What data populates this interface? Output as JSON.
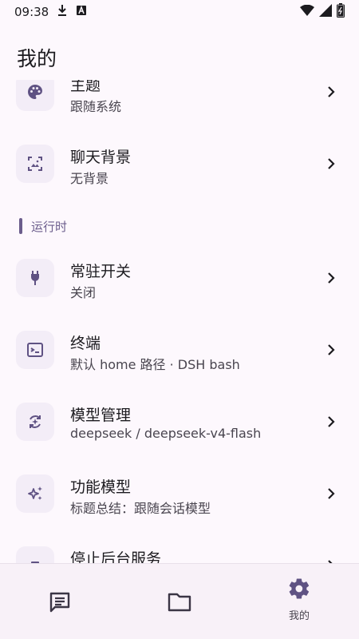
{
  "status_bar": {
    "time": "09:38",
    "icons": [
      "download-icon",
      "a-icon",
      "wifi-icon",
      "signal-icon",
      "battery-icon"
    ]
  },
  "page_title": "我的",
  "settings": {
    "partial_top_item": {
      "title": "主题",
      "subtitle": "跟随系统",
      "icon": "palette-icon"
    },
    "items_before": [
      {
        "title": "聊天背景",
        "subtitle": "无背景",
        "icon": "wallpaper-icon"
      }
    ],
    "section_label": "运行时",
    "items": [
      {
        "title": "常驻开关",
        "subtitle": "关闭",
        "icon": "plug-icon"
      },
      {
        "title": "终端",
        "subtitle": "默认 home 路径 · DSH bash",
        "icon": "terminal-icon"
      },
      {
        "title": "模型管理",
        "subtitle": "deepseek / deepseek-v4-flash",
        "icon": "model-sync-icon"
      },
      {
        "title": "功能模型",
        "subtitle": "标题总结：跟随会话模型",
        "icon": "sparkle-icon"
      },
      {
        "title": "停止后台服务",
        "subtitle": "",
        "icon": "stop-icon"
      }
    ]
  },
  "bottom_nav": {
    "items": [
      {
        "name": "chat",
        "label": "",
        "icon": "chat-icon"
      },
      {
        "name": "files",
        "label": "",
        "icon": "folder-icon"
      },
      {
        "name": "mine",
        "label": "我的",
        "icon": "gear-icon"
      }
    ],
    "active": "mine"
  },
  "colors": {
    "background": "#fdf8fd",
    "icon_tint": "#5f5283",
    "accent": "#6b5d8c",
    "icon_box": "#f3edf7",
    "nav_bg": "#f8f1f8"
  }
}
